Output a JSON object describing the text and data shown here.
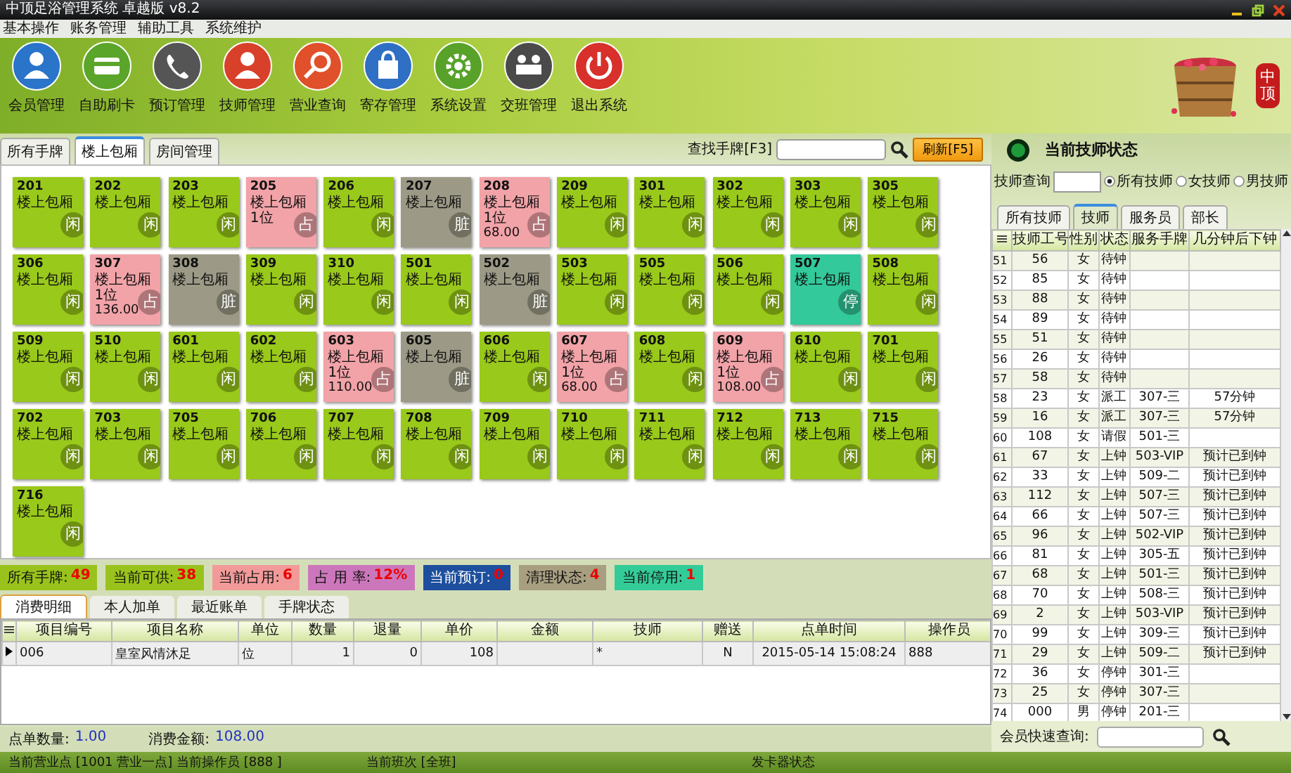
{
  "window": {
    "title": "中顶足浴管理系统 卓越版 v8.2"
  },
  "menu": [
    "基本操作",
    "账务管理",
    "辅助工具",
    "系统维护"
  ],
  "toolbar": [
    {
      "label": "会员管理",
      "kind": "person"
    },
    {
      "label": "自助刷卡",
      "kind": "card"
    },
    {
      "label": "预订管理",
      "kind": "phone"
    },
    {
      "label": "技师管理",
      "kind": "staff"
    },
    {
      "label": "营业查询",
      "kind": "search"
    },
    {
      "label": "寄存管理",
      "kind": "bag"
    },
    {
      "label": "系统设置",
      "kind": "gear"
    },
    {
      "label": "交班管理",
      "kind": "team"
    },
    {
      "label": "退出系统",
      "kind": "power"
    }
  ],
  "logo": {
    "text": "中顶"
  },
  "room_tabs": [
    {
      "label": "所有手牌",
      "selected": false
    },
    {
      "label": "楼上包厢",
      "selected": true
    },
    {
      "label": "房间管理",
      "selected": false
    }
  ],
  "room_search": {
    "label": "查找手牌[F3]",
    "refresh": "刷新[F5]"
  },
  "rooms": [
    {
      "number": "201",
      "type": "楼上包厢",
      "kind": "free",
      "badge": "闲"
    },
    {
      "number": "202",
      "type": "楼上包厢",
      "kind": "free",
      "badge": "闲"
    },
    {
      "number": "203",
      "type": "楼上包厢",
      "kind": "free",
      "badge": "闲"
    },
    {
      "number": "205",
      "type": "楼上包厢",
      "kind": "occupied",
      "badge": "占",
      "guests": "1位"
    },
    {
      "number": "206",
      "type": "楼上包厢",
      "kind": "free",
      "badge": "闲"
    },
    {
      "number": "207",
      "type": "楼上包厢",
      "kind": "dirty",
      "badge": "脏"
    },
    {
      "number": "208",
      "type": "楼上包厢",
      "kind": "occupied",
      "badge": "占",
      "guests": "1位",
      "amount": "68.00"
    },
    {
      "number": "209",
      "type": "楼上包厢",
      "kind": "free",
      "badge": "闲"
    },
    {
      "number": "301",
      "type": "楼上包厢",
      "kind": "free",
      "badge": "闲"
    },
    {
      "number": "302",
      "type": "楼上包厢",
      "kind": "free",
      "badge": "闲"
    },
    {
      "number": "303",
      "type": "楼上包厢",
      "kind": "free",
      "badge": "闲"
    },
    {
      "number": "305",
      "type": "楼上包厢",
      "kind": "free",
      "badge": "闲"
    },
    {
      "number": "306",
      "type": "楼上包厢",
      "kind": "free",
      "badge": "闲"
    },
    {
      "number": "307",
      "type": "楼上包厢",
      "kind": "occupied",
      "badge": "占",
      "guests": "1位",
      "amount": "136.00"
    },
    {
      "number": "308",
      "type": "楼上包厢",
      "kind": "dirty",
      "badge": "脏"
    },
    {
      "number": "309",
      "type": "楼上包厢",
      "kind": "free",
      "badge": "闲"
    },
    {
      "number": "310",
      "type": "楼上包厢",
      "kind": "free",
      "badge": "闲"
    },
    {
      "number": "501",
      "type": "楼上包厢",
      "kind": "free",
      "badge": "闲"
    },
    {
      "number": "502",
      "type": "楼上包厢",
      "kind": "dirty",
      "badge": "脏"
    },
    {
      "number": "503",
      "type": "楼上包厢",
      "kind": "free",
      "badge": "闲"
    },
    {
      "number": "505",
      "type": "楼上包厢",
      "kind": "free",
      "badge": "闲"
    },
    {
      "number": "506",
      "type": "楼上包厢",
      "kind": "free",
      "badge": "闲"
    },
    {
      "number": "507",
      "type": "楼上包厢",
      "kind": "stopped",
      "badge": "停"
    },
    {
      "number": "508",
      "type": "楼上包厢",
      "kind": "free",
      "badge": "闲"
    },
    {
      "number": "509",
      "type": "楼上包厢",
      "kind": "free",
      "badge": "闲"
    },
    {
      "number": "510",
      "type": "楼上包厢",
      "kind": "free",
      "badge": "闲"
    },
    {
      "number": "601",
      "type": "楼上包厢",
      "kind": "free",
      "badge": "闲"
    },
    {
      "number": "602",
      "type": "楼上包厢",
      "kind": "free",
      "badge": "闲"
    },
    {
      "number": "603",
      "type": "楼上包厢",
      "kind": "occupied",
      "badge": "占",
      "guests": "1位",
      "amount": "110.00"
    },
    {
      "number": "605",
      "type": "楼上包厢",
      "kind": "dirty",
      "badge": "脏"
    },
    {
      "number": "606",
      "type": "楼上包厢",
      "kind": "free",
      "badge": "闲"
    },
    {
      "number": "607",
      "type": "楼上包厢",
      "kind": "occupied",
      "badge": "占",
      "guests": "1位",
      "amount": "68.00"
    },
    {
      "number": "608",
      "type": "楼上包厢",
      "kind": "free",
      "badge": "闲"
    },
    {
      "number": "609",
      "type": "楼上包厢",
      "kind": "occupied",
      "badge": "占",
      "guests": "1位",
      "amount": "108.00"
    },
    {
      "number": "610",
      "type": "楼上包厢",
      "kind": "free",
      "badge": "闲"
    },
    {
      "number": "701",
      "type": "楼上包厢",
      "kind": "free",
      "badge": "闲"
    },
    {
      "number": "702",
      "type": "楼上包厢",
      "kind": "free",
      "badge": "闲"
    },
    {
      "number": "703",
      "type": "楼上包厢",
      "kind": "free",
      "badge": "闲"
    },
    {
      "number": "705",
      "type": "楼上包厢",
      "kind": "free",
      "badge": "闲"
    },
    {
      "number": "706",
      "type": "楼上包厢",
      "kind": "free",
      "badge": "闲"
    },
    {
      "number": "707",
      "type": "楼上包厢",
      "kind": "free",
      "badge": "闲"
    },
    {
      "number": "708",
      "type": "楼上包厢",
      "kind": "free",
      "badge": "闲"
    },
    {
      "number": "709",
      "type": "楼上包厢",
      "kind": "free",
      "badge": "闲"
    },
    {
      "number": "710",
      "type": "楼上包厢",
      "kind": "free",
      "badge": "闲"
    },
    {
      "number": "711",
      "type": "楼上包厢",
      "kind": "free",
      "badge": "闲"
    },
    {
      "number": "712",
      "type": "楼上包厢",
      "kind": "free",
      "badge": "闲"
    },
    {
      "number": "713",
      "type": "楼上包厢",
      "kind": "free",
      "badge": "闲"
    },
    {
      "number": "715",
      "type": "楼上包厢",
      "kind": "free",
      "badge": "闲"
    },
    {
      "number": "716",
      "type": "楼上包厢",
      "kind": "free",
      "badge": "闲"
    }
  ],
  "stats": [
    {
      "label": "所有手牌:",
      "value": "49",
      "color": "#99c31c"
    },
    {
      "label": "当前可供:",
      "value": "38",
      "color": "#99c31c"
    },
    {
      "label": "当前占用:",
      "value": "6",
      "color": "#f29a9a"
    },
    {
      "label": "占 用 率:",
      "value": "12%",
      "color": "#cc77bb"
    },
    {
      "label": "当前预订:",
      "value": "0",
      "color": "#1e4f9e"
    },
    {
      "label": "清理状态:",
      "value": "4",
      "color": "#a89e80"
    },
    {
      "label": "当前停用:",
      "value": "1",
      "color": "#33cc99"
    }
  ],
  "detail_tabs": [
    {
      "label": "消费明细",
      "selected": true
    },
    {
      "label": "本人加单",
      "selected": false
    },
    {
      "label": "最近账单",
      "selected": false
    },
    {
      "label": "手牌状态",
      "selected": false
    }
  ],
  "detail_table": {
    "columns": [
      "项目编号",
      "项目名称",
      "单位",
      "数量",
      "退量",
      "单价",
      "金额",
      "技师",
      "赠送",
      "点单时间",
      "操作员"
    ],
    "rows": [
      {
        "current": true,
        "cells": [
          "006",
          "皇室风情沐足",
          "位",
          "1",
          "0",
          "108",
          null,
          "*",
          "N",
          "2015-05-14 15:08:24",
          "888"
        ]
      }
    ]
  },
  "summary": [
    {
      "label": "点单数量:",
      "value": "1.00"
    },
    {
      "label": "消费金额:",
      "value": "108.00"
    }
  ],
  "status_bar": [
    "当前营业点 [1001 营业一点] 当前操作员 [888 ]",
    "当前班次 [全班]",
    "发卡器状态"
  ],
  "technician_panel": {
    "title": "当前技师状态",
    "query_label": "技师查询",
    "filters": [
      {
        "label": "所有技师",
        "checked": true
      },
      {
        "label": "女技师",
        "checked": false
      },
      {
        "label": "男技师",
        "checked": false
      }
    ],
    "tabs": [
      {
        "label": "所有技师",
        "selected": false
      },
      {
        "label": "技师",
        "selected": true
      },
      {
        "label": "服务员",
        "selected": false
      },
      {
        "label": "部长",
        "selected": false
      }
    ],
    "columns": [
      "技师工号",
      "性别",
      "状态",
      "服务手牌",
      "几分钟后下钟"
    ],
    "rows": [
      {
        "no": "51",
        "id": "56",
        "sex": "女",
        "state": "待钟"
      },
      {
        "no": "52",
        "id": "85",
        "sex": "女",
        "state": "待钟"
      },
      {
        "no": "53",
        "id": "88",
        "sex": "女",
        "state": "待钟"
      },
      {
        "no": "54",
        "id": "89",
        "sex": "女",
        "state": "待钟"
      },
      {
        "no": "55",
        "id": "51",
        "sex": "女",
        "state": "待钟"
      },
      {
        "no": "56",
        "id": "26",
        "sex": "女",
        "state": "待钟"
      },
      {
        "no": "57",
        "id": "58",
        "sex": "女",
        "state": "待钟"
      },
      {
        "no": "58",
        "id": "23",
        "sex": "女",
        "state": "派工",
        "room": "307-三",
        "due": "57分钟"
      },
      {
        "no": "59",
        "id": "16",
        "sex": "女",
        "state": "派工",
        "room": "307-三",
        "due": "57分钟"
      },
      {
        "no": "60",
        "id": "108",
        "sex": "女",
        "state": "请假",
        "room": "501-三"
      },
      {
        "no": "61",
        "id": "67",
        "sex": "女",
        "state": "上钟",
        "room": "503-VIP",
        "due": "预计已到钟"
      },
      {
        "no": "62",
        "id": "33",
        "sex": "女",
        "state": "上钟",
        "room": "509-二",
        "due": "预计已到钟"
      },
      {
        "no": "63",
        "id": "112",
        "sex": "女",
        "state": "上钟",
        "room": "507-三",
        "due": "预计已到钟"
      },
      {
        "no": "64",
        "id": "66",
        "sex": "女",
        "state": "上钟",
        "room": "507-三",
        "due": "预计已到钟"
      },
      {
        "no": "65",
        "id": "96",
        "sex": "女",
        "state": "上钟",
        "room": "502-VIP",
        "due": "预计已到钟"
      },
      {
        "no": "66",
        "id": "81",
        "sex": "女",
        "state": "上钟",
        "room": "305-五",
        "due": "预计已到钟"
      },
      {
        "no": "67",
        "id": "68",
        "sex": "女",
        "state": "上钟",
        "room": "501-三",
        "due": "预计已到钟"
      },
      {
        "no": "68",
        "id": "70",
        "sex": "女",
        "state": "上钟",
        "room": "508-三",
        "due": "预计已到钟"
      },
      {
        "no": "69",
        "id": "2",
        "sex": "女",
        "state": "上钟",
        "room": "503-VIP",
        "due": "预计已到钟"
      },
      {
        "no": "70",
        "id": "99",
        "sex": "女",
        "state": "上钟",
        "room": "309-三",
        "due": "预计已到钟"
      },
      {
        "no": "71",
        "id": "29",
        "sex": "女",
        "state": "上钟",
        "room": "509-二",
        "due": "预计已到钟"
      },
      {
        "no": "72",
        "id": "36",
        "sex": "女",
        "state": "停钟",
        "room": "301-三"
      },
      {
        "no": "73",
        "id": "25",
        "sex": "女",
        "state": "停钟",
        "room": "307-三"
      },
      {
        "no": "74",
        "id": "000",
        "sex": "男",
        "state": "停钟",
        "room": "201-三"
      }
    ],
    "member_search_label": "会员快速查询:"
  }
}
